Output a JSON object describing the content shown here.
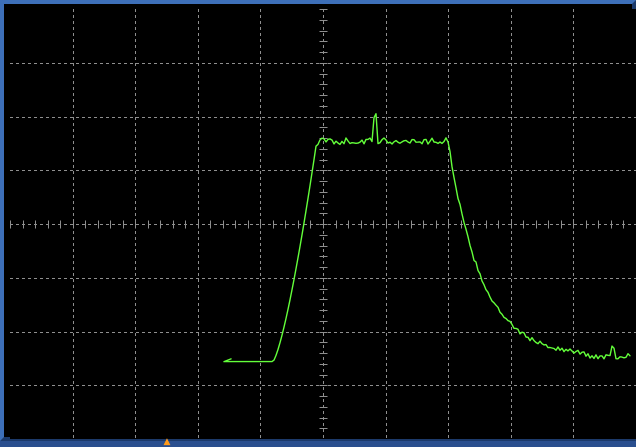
{
  "app": {
    "name": "",
    "window_title": ""
  },
  "screen": {
    "trace_color": "#63ff3a",
    "grid_color": "#8f8f8f",
    "background": "#000000",
    "frame_color": "#2f5fa3"
  },
  "grid": {
    "horizontal_divisions": 10,
    "vertical_divisions": 8,
    "minor_ticks_per_division": 5,
    "center_crosshair": true
  },
  "trace": {
    "shape": "pulse",
    "baseline_left_level": -2.55,
    "high_level": 1.55,
    "baseline_right_level": -2.45,
    "rise_start_division": 4.2,
    "rise_end_division": 4.9,
    "fall_start_division": 7.0,
    "fall_end_division": 9.2
  },
  "markers": {
    "trigger_marker_symbol": "▲"
  }
}
